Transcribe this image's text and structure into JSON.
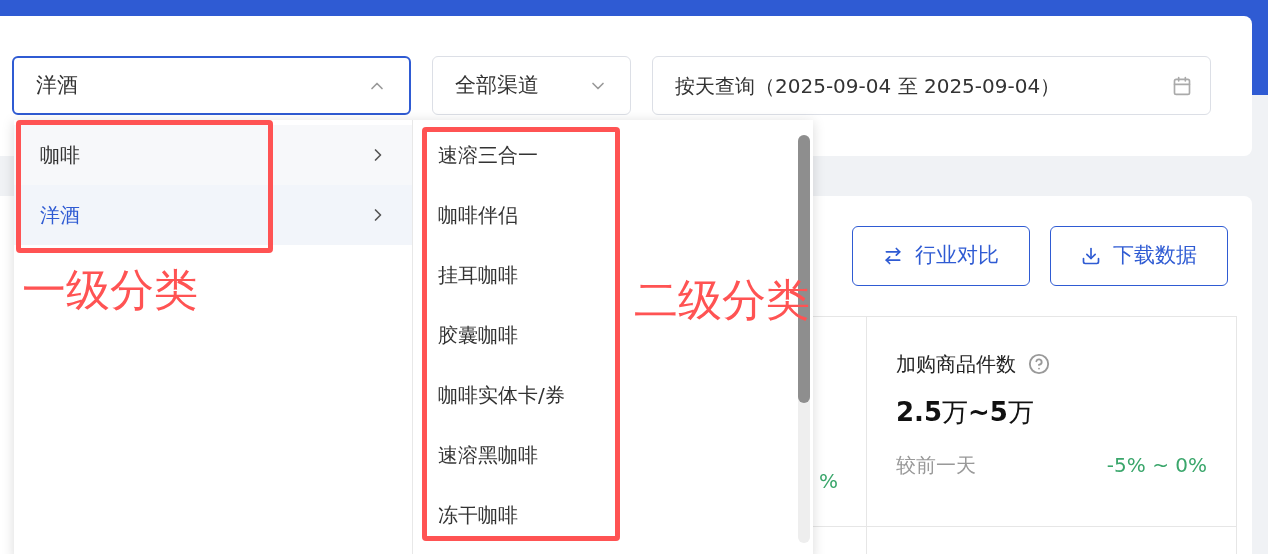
{
  "filters": {
    "category_select": {
      "value": "洋酒",
      "open": true
    },
    "channel_select": {
      "value": "全部渠道"
    },
    "date_field": {
      "value": "按天查询（2025-09-04 至 2025-09-04）"
    }
  },
  "cascader": {
    "level1": [
      {
        "label": "咖啡",
        "selected": false
      },
      {
        "label": "洋酒",
        "selected": true
      }
    ],
    "level2": [
      {
        "label": "速溶三合一"
      },
      {
        "label": "咖啡伴侣"
      },
      {
        "label": "挂耳咖啡"
      },
      {
        "label": "胶囊咖啡"
      },
      {
        "label": "咖啡实体卡/券"
      },
      {
        "label": "速溶黑咖啡"
      },
      {
        "label": "冻干咖啡"
      }
    ]
  },
  "annotations": [
    {
      "label": "一级分类",
      "kind": "level1"
    },
    {
      "label": "二级分类",
      "kind": "level2"
    }
  ],
  "actions": [
    {
      "label": "行业对比",
      "kind": "compare"
    },
    {
      "label": "下载数据",
      "kind": "download"
    }
  ],
  "metrics": [
    {
      "change": "%"
    },
    {
      "title": "加购商品件数",
      "value": "**2.5**万**~5**万",
      "compare_label": "较前一天",
      "change": "-5% ~ 0%"
    }
  ]
}
